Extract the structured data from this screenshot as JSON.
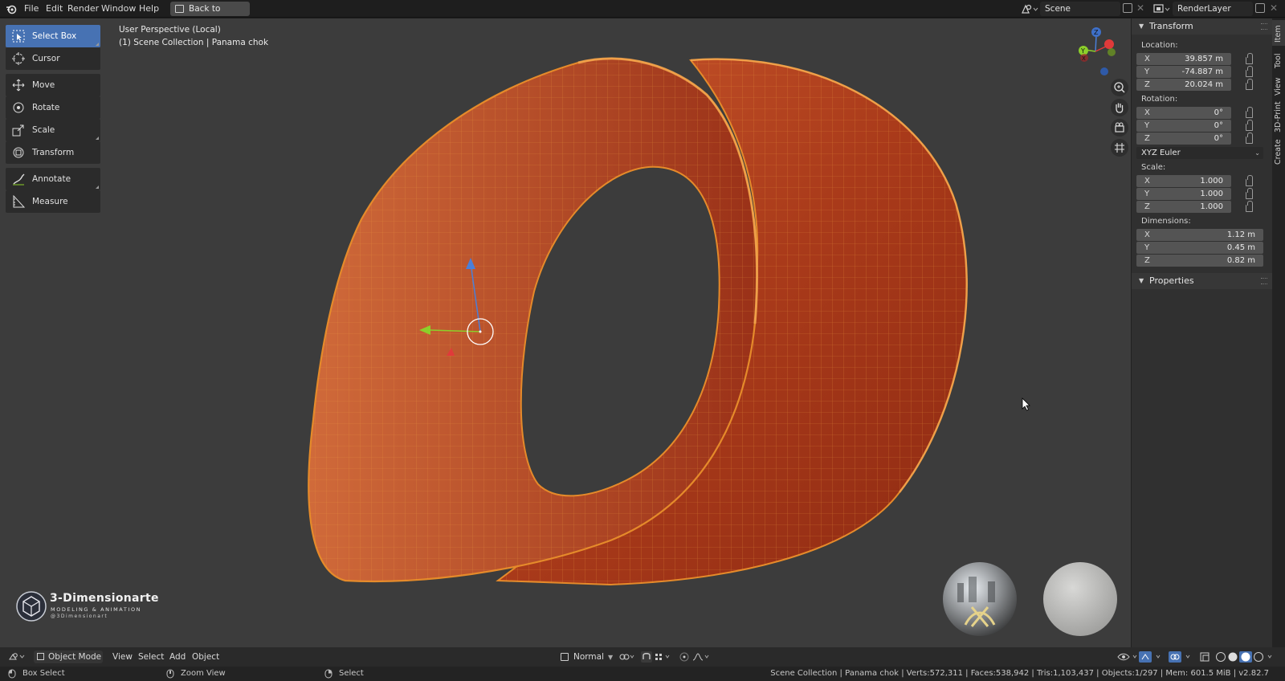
{
  "menu": {
    "file": "File",
    "edit": "Edit",
    "render": "Render",
    "window": "Window",
    "help": "Help",
    "back_button": "Back to Previous"
  },
  "scene": {
    "name": "Scene",
    "render_layer": "RenderLayer"
  },
  "viewport": {
    "perspective_label": "User Perspective (Local)",
    "collection_label": "(1) Scene Collection | Panama chok"
  },
  "toolbar": {
    "tools": [
      {
        "label": "Select Box",
        "icon": "select-box-icon",
        "active": true
      },
      {
        "label": "Cursor",
        "icon": "cursor-icon"
      },
      {
        "label": "Move",
        "icon": "move-icon"
      },
      {
        "label": "Rotate",
        "icon": "rotate-icon"
      },
      {
        "label": "Scale",
        "icon": "scale-icon"
      },
      {
        "label": "Transform",
        "icon": "transform-icon"
      },
      {
        "label": "Annotate",
        "icon": "annotate-icon"
      },
      {
        "label": "Measure",
        "icon": "measure-icon"
      }
    ]
  },
  "gizmo": {
    "x": "X",
    "y": "Y",
    "z": "Z"
  },
  "sidebar": {
    "tabs": [
      "Item",
      "Tool",
      "View",
      "3D-Print",
      "Create"
    ],
    "transform_title": "Transform",
    "location_label": "Location:",
    "location": {
      "x": "39.857 m",
      "y": "-74.887 m",
      "z": "20.024 m"
    },
    "rotation_label": "Rotation:",
    "rotation": {
      "x": "0°",
      "y": "0°",
      "z": "0°"
    },
    "rotation_mode": "XYZ Euler",
    "scale_label": "Scale:",
    "scale": {
      "x": "1.000",
      "y": "1.000",
      "z": "1.000"
    },
    "dimensions_label": "Dimensions:",
    "dimensions": {
      "x": "1.12 m",
      "y": "0.45 m",
      "z": "0.82 m"
    },
    "properties_title": "Properties",
    "axis_x": "X",
    "axis_y": "Y",
    "axis_z": "Z"
  },
  "footer": {
    "mode": "Object Mode",
    "view": "View",
    "select": "Select",
    "add": "Add",
    "object": "Object",
    "orientation": "Normal"
  },
  "status": {
    "box_select": "Box Select",
    "zoom_view": "Zoom View",
    "select": "Select",
    "stats": "Scene Collection | Panama chok | Verts:572,311 | Faces:538,942 | Tris:1,103,437 | Objects:1/297 | Mem: 601.5 MiB | v2.82.7"
  },
  "logo": {
    "title": "3-Dimensionarte",
    "tagline": "Modeling & Animation",
    "handle": "@3Dimensionart"
  },
  "colors": {
    "accent": "#4772b3",
    "mesh_orange": "#e58a2a",
    "mesh_fill": "#b8421f",
    "viewport_bg": "#3c3c3c"
  }
}
